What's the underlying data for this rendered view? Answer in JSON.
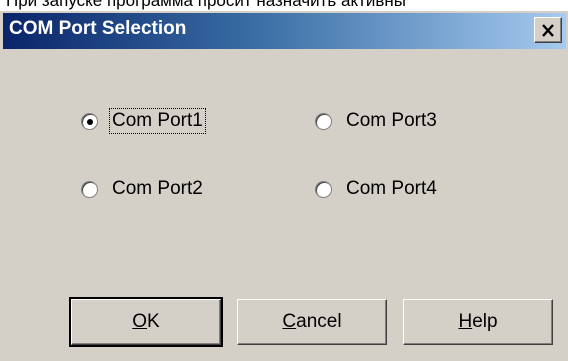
{
  "background_text": "При запуске программа просит назначить активны",
  "dialog": {
    "title": "COM Port Selection",
    "close_symbol": "×"
  },
  "ports": [
    {
      "label": "Com Port1",
      "selected": true
    },
    {
      "label": "Com Port2",
      "selected": false
    },
    {
      "label": "Com Port3",
      "selected": false
    },
    {
      "label": "Com Port4",
      "selected": false
    }
  ],
  "buttons": {
    "ok": {
      "mnemonic": "O",
      "rest": "K"
    },
    "cancel": {
      "mnemonic": "C",
      "rest": "ancel"
    },
    "help": {
      "mnemonic": "H",
      "rest": "elp"
    }
  },
  "colors": {
    "dialog_bg": "#d4d0c8",
    "title_gradient_start": "#0a246a",
    "title_gradient_end": "#a6caf0",
    "title_text": "#ffffff"
  }
}
